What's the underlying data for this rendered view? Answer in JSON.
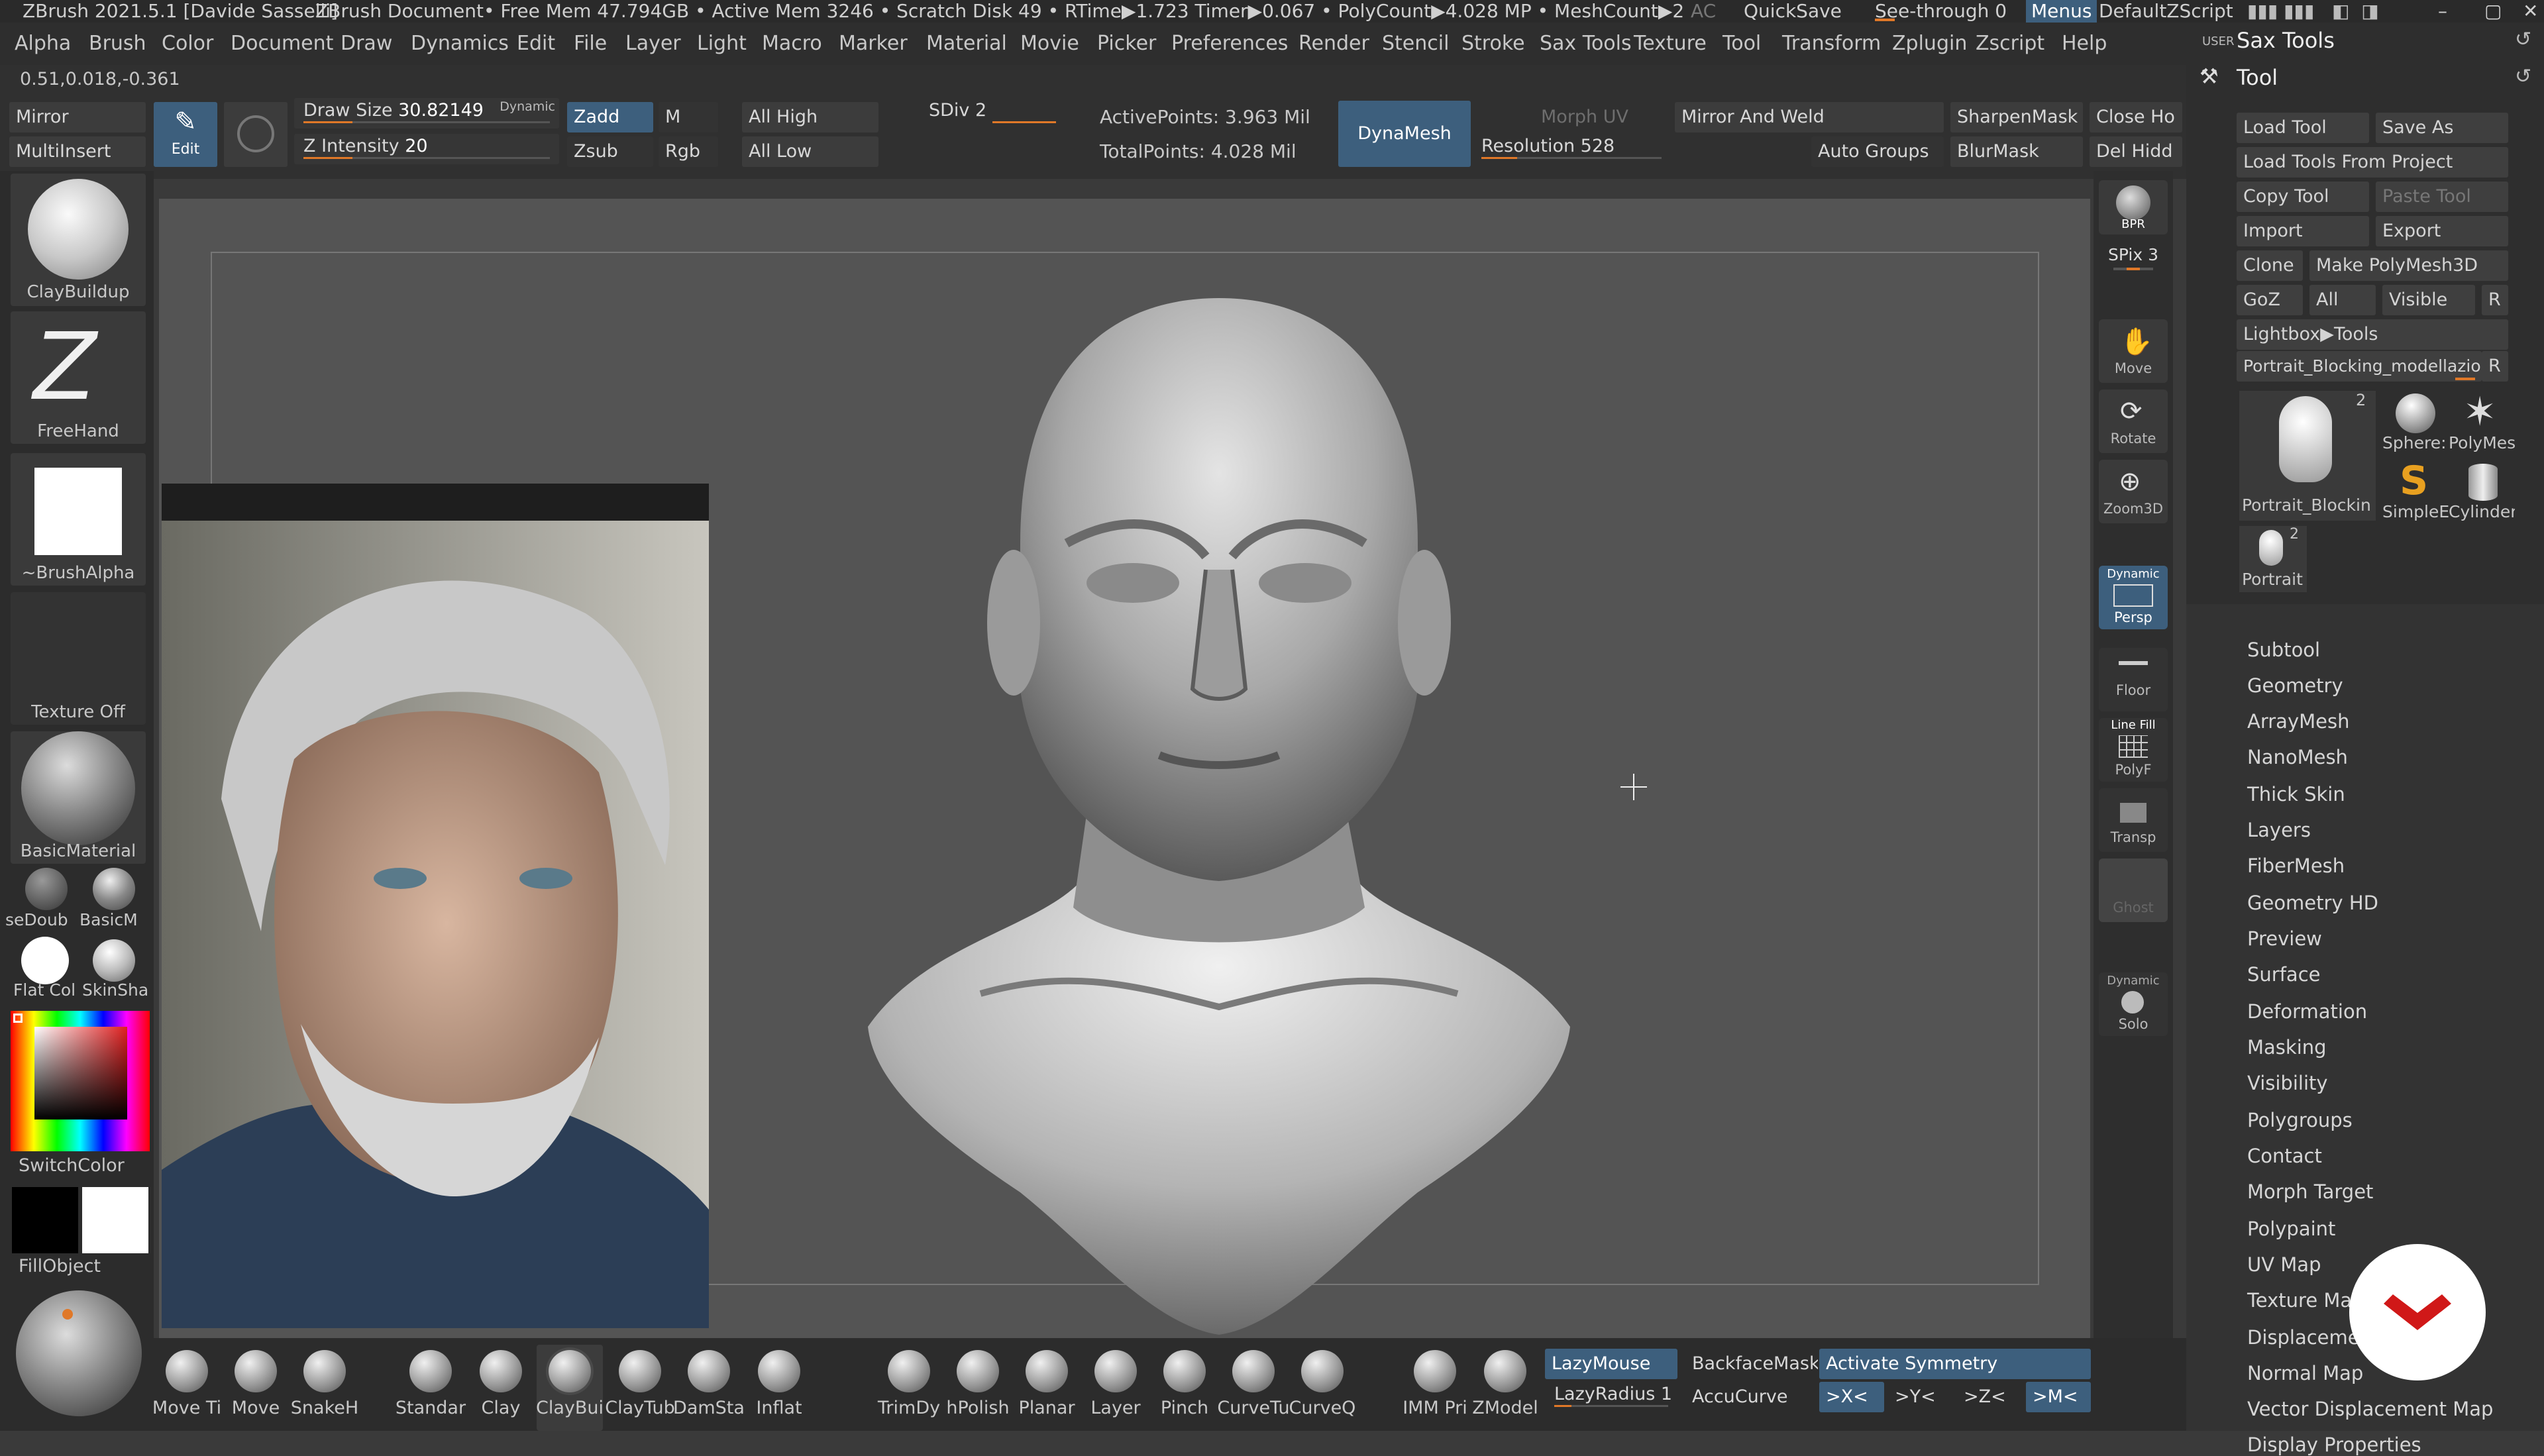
{
  "title_bar": {
    "app_title": "ZBrush 2021.5.1 [Davide Sasselli]",
    "document": "ZBrush Document",
    "stats": "• Free Mem 47.794GB • Active Mem 3246 • Scratch Disk 49 • RTime▶1.723 Timer▶0.067 • PolyCount▶4.028 MP • MeshCount▶2",
    "ac": "AC",
    "quicksave": "QuickSave",
    "see_through": "See-through  0",
    "menus": "Menus",
    "script": "DefaultZScript"
  },
  "menu": [
    "Alpha",
    "Brush",
    "Color",
    "Document",
    "Draw",
    "Dynamics",
    "Edit",
    "File",
    "Layer",
    "Light",
    "Macro",
    "Marker",
    "Material",
    "Movie",
    "Picker",
    "Preferences",
    "Render",
    "Stencil",
    "Stroke",
    "Sax Tools",
    "Texture",
    "Tool",
    "Transform",
    "Zplugin",
    "Zscript",
    "Help"
  ],
  "coords": "0.51,0.018,-0.361",
  "toolbar": {
    "mirror": "Mirror",
    "multiinsert": "MultiInsert",
    "edit": "Edit",
    "draw_size_label": "Draw Size",
    "draw_size_value": "30.82149",
    "dynamic": "Dynamic",
    "z_intensity_label": "Z Intensity",
    "z_intensity_value": "20",
    "zadd": "Zadd",
    "zsub": "Zsub",
    "m": "M",
    "rgb": "Rgb",
    "all_high": "All High",
    "all_low": "All Low",
    "sdiv": "SDiv 2",
    "active_points": "ActivePoints: 3.963 Mil",
    "total_points": "TotalPoints: 4.028 Mil",
    "dynamesh": "DynaMesh",
    "morph_uv": "Morph UV",
    "resolution": "Resolution 528",
    "mirror_weld": "Mirror And Weld",
    "auto_groups": "Auto Groups",
    "sharpenmask": "SharpenMask",
    "blurmask": "BlurMask",
    "close_holes": "Close Ho",
    "del_hidden": "Del Hidd"
  },
  "left_shelf": {
    "brush": "ClayBuildup",
    "stroke": "FreeHand",
    "alpha": "~BrushAlpha",
    "texture": "Texture Off",
    "material": "BasicMaterial",
    "mat_a": "seDoub",
    "mat_b": "BasicM",
    "mat_c": "Flat Col",
    "mat_d": "SkinSha",
    "switch_color": "SwitchColor",
    "fill_object": "FillObject"
  },
  "right_toolbar": {
    "bpr": "BPR",
    "spix": "SPix 3",
    "move": "Move",
    "rotate": "Rotate",
    "zoom": "Zoom3D",
    "persp_dynamic": "Dynamic",
    "persp": "Persp",
    "floor": "Floor",
    "linefill": "Line Fill",
    "polyf": "PolyF",
    "transp": "Transp",
    "ghost": "Ghost",
    "solo_dynamic": "Dynamic",
    "solo": "Solo"
  },
  "right_panel": {
    "user": "USER",
    "sax_tools": "Sax Tools",
    "tool": "Tool",
    "buttons": {
      "load_tool": "Load Tool",
      "save_as": "Save As",
      "load_from_project": "Load Tools From Project",
      "copy_tool": "Copy Tool",
      "paste_tool": "Paste Tool",
      "import": "Import",
      "export": "Export",
      "clone": "Clone",
      "make_polymesh": "Make PolyMesh3D",
      "goz": "GoZ",
      "all": "All",
      "visible": "Visible",
      "r": "R",
      "lightbox": "Lightbox▶Tools",
      "current_tool": "Portrait_Blocking_modellazio",
      "r2": "R"
    },
    "thumbs": {
      "main_label": "Portrait_Blockin",
      "main_count": "2",
      "sphere": "Sphere:",
      "polymesh": "PolyMes",
      "simple": "SimpleE",
      "cylinder": "Cylinder",
      "small_label": "Portrait",
      "small_count": "2"
    },
    "subpalettes": [
      "Subtool",
      "Geometry",
      "ArrayMesh",
      "NanoMesh",
      "Thick Skin",
      "Layers",
      "FiberMesh",
      "Geometry HD",
      "Preview",
      "Surface",
      "Deformation",
      "Masking",
      "Visibility",
      "Polygroups",
      "Contact",
      "Morph Target",
      "Polypaint",
      "UV Map",
      "Texture Map",
      "Displaceme",
      "Normal Map",
      "Vector Displacement Map",
      "Display Properties"
    ]
  },
  "bottom_shelf": {
    "brushes": [
      "Move Ti",
      "Move",
      "SnakeH",
      "Standar",
      "Clay",
      "ClayBui",
      "ClayTub",
      "DamSta",
      "Inflat",
      "TrimDy",
      "hPolish",
      "Planar",
      "Layer",
      "Pinch",
      "CurveTu",
      "CurveQ",
      "IMM Pri",
      "ZModel"
    ],
    "lazymouse": "LazyMouse",
    "lazyradius": "LazyRadius 1",
    "backfacemask": "BackfaceMask",
    "accucurve": "AccuCurve",
    "activate_symmetry": "Activate Symmetry",
    "sym_x": ">X<",
    "sym_y": ">Y<",
    "sym_z": ">Z<",
    "sym_m": ">M<"
  },
  "colors": {
    "accent": "#e07828",
    "highlight_blue": "#3d5f7d",
    "background": "#3a3a3a",
    "viewport": "#545454"
  }
}
